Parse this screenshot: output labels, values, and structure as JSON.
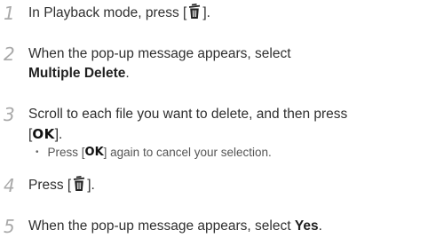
{
  "steps": [
    {
      "number": "1",
      "before": "In Playback mode, press [",
      "icon": "trash-icon",
      "after": "]."
    },
    {
      "number": "2",
      "line1": "When the pop-up message appears, select",
      "bold": "Multiple Delete",
      "after": "."
    },
    {
      "number": "3",
      "line1": "Scroll to each file you want to delete, and then press",
      "open": "[",
      "ok": "OK",
      "close": "]."
    },
    {
      "number": "4",
      "before": "Press [",
      "icon": "trash-icon",
      "after": "]."
    },
    {
      "number": "5",
      "before": "When the pop-up message appears, select ",
      "bold": "Yes",
      "after": "."
    }
  ],
  "note": {
    "bullet": "•",
    "before": "Press [",
    "ok": "OK",
    "after": "] again to cancel your selection."
  },
  "colors": {
    "step_number": "#a9a9a9",
    "body_text": "#2f2f2f"
  }
}
